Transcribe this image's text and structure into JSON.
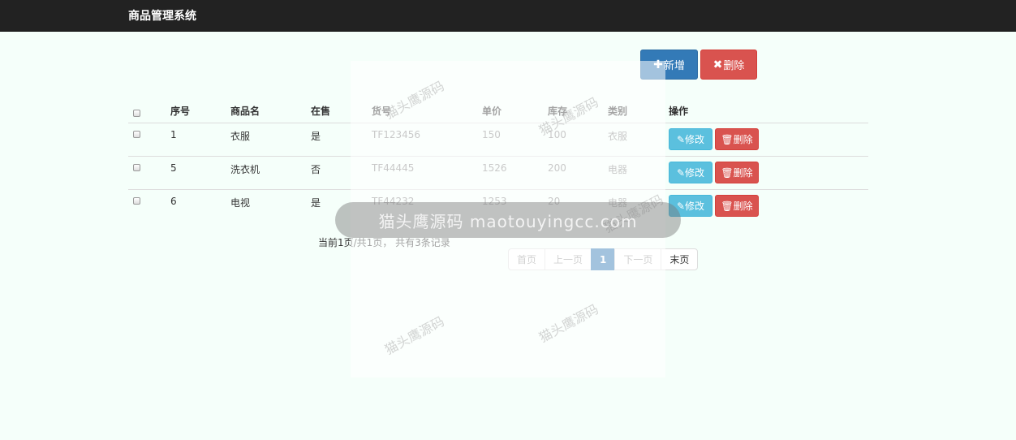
{
  "app": {
    "title": "商品管理系统"
  },
  "toolbar": {
    "add_icon": "plus-icon",
    "add_label": "新增",
    "delete_icon": "times-icon",
    "delete_label": "删除"
  },
  "table": {
    "headers": [
      "序号",
      "商品名",
      "在售",
      "货号",
      "单价",
      "库存",
      "类别",
      "操作"
    ],
    "rows": [
      {
        "id": "1",
        "name": "衣服",
        "on_sale": "是",
        "sku": "TF123456",
        "price": "150",
        "stock": "100",
        "category": "衣服"
      },
      {
        "id": "5",
        "name": "洗衣机",
        "on_sale": "否",
        "sku": "TF44445",
        "price": "1526",
        "stock": "200",
        "category": "电器"
      },
      {
        "id": "6",
        "name": "电视",
        "on_sale": "是",
        "sku": "TF44232",
        "price": "1253",
        "stock": "20",
        "category": "电器"
      }
    ],
    "edit_label": "修改",
    "delete_label": "删除"
  },
  "pagination": {
    "info": "当前1页/共1页， 共有3条记录",
    "first": "首页",
    "prev": "上一页",
    "current": "1",
    "next": "下一页",
    "last": "末页"
  },
  "watermark": {
    "pill_text": "猫头鹰源码 maotouyingcc.com",
    "diag_text": "猫头鹰源码"
  },
  "colors": {
    "primary": "#337ab7",
    "danger": "#d9534f",
    "info": "#5bc0de",
    "navbar": "#222222",
    "background": "#f5fffa"
  }
}
